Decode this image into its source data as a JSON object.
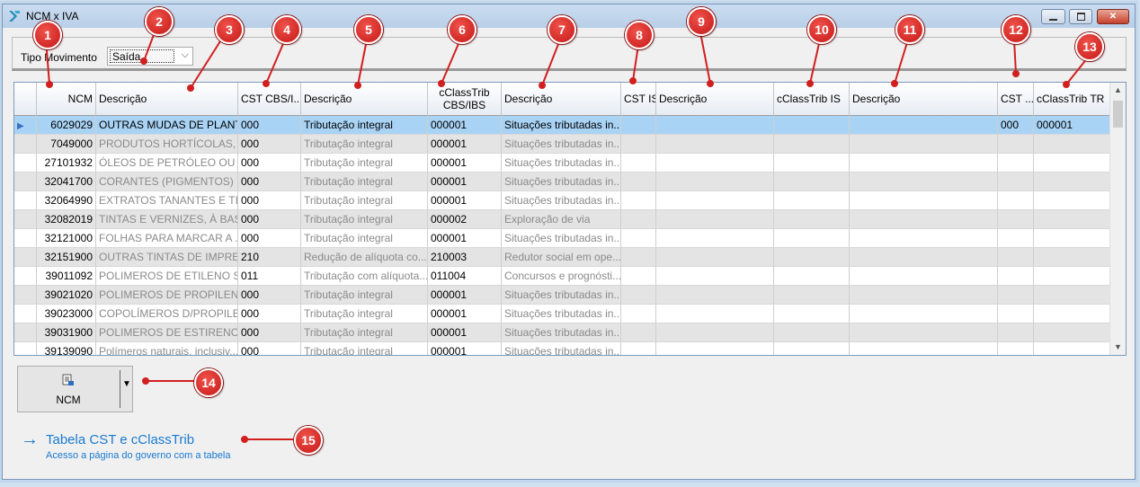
{
  "window": {
    "title": "NCM x IVA",
    "controls": [
      "minimize-icon",
      "maximize-icon",
      "close-icon"
    ]
  },
  "filter": {
    "label": "Tipo Movimento",
    "value": "Saída"
  },
  "grid": {
    "columns": [
      "NCM",
      "Descrição",
      "CST CBS/I...",
      "Descrição",
      "cClassTrib CBS/IBS",
      "Descrição",
      "CST IS",
      "Descrição",
      "cClassTrib IS",
      "Descrição",
      "CST ...",
      "cClassTrib TR"
    ],
    "rows": [
      [
        "6029029",
        "OUTRAS MUDAS DE PLANT...",
        "000",
        "Tributação integral",
        "000001",
        "Situações tributadas in...",
        "",
        "",
        "",
        "",
        "000",
        "000001"
      ],
      [
        "7049000",
        "PRODUTOS HORTÍCOLAS, P...",
        "000",
        "Tributação integral",
        "000001",
        "Situações tributadas in...",
        "",
        "",
        "",
        "",
        "",
        ""
      ],
      [
        "27101932",
        "ÓLEOS DE PETRÓLEO OU D...",
        "000",
        "Tributação integral",
        "000001",
        "Situações tributadas in...",
        "",
        "",
        "",
        "",
        "",
        ""
      ],
      [
        "32041700",
        "CORANTES (PIGMENTOS) N...",
        "000",
        "Tributação integral",
        "000001",
        "Situações tributadas in...",
        "",
        "",
        "",
        "",
        "",
        ""
      ],
      [
        "32064990",
        "EXTRATOS TANANTES E TIN...",
        "000",
        "Tributação integral",
        "000001",
        "Situações tributadas in...",
        "",
        "",
        "",
        "",
        "",
        ""
      ],
      [
        "32082019",
        "TINTAS E VERNIZES, À BASE...",
        "000",
        "Tributação integral",
        "000002",
        "Exploração de via",
        "",
        "",
        "",
        "",
        "",
        ""
      ],
      [
        "32121000",
        "FOLHAS PARA MARCAR A ...",
        "000",
        "Tributação integral",
        "000001",
        "Situações tributadas in...",
        "",
        "",
        "",
        "",
        "",
        ""
      ],
      [
        "32151900",
        "OUTRAS TINTAS DE IMPRES...",
        "210",
        "Redução de alíquota co...",
        "210003",
        "Redutor social em ope...",
        "",
        "",
        "",
        "",
        "",
        ""
      ],
      [
        "39011092",
        "POLIMEROS DE ETILENO SE...",
        "011",
        "Tributação com alíquota...",
        "011004",
        "Concursos e prognósti...",
        "",
        "",
        "",
        "",
        "",
        ""
      ],
      [
        "39021020",
        "POLIMEROS DE PROPILEN...",
        "000",
        "Tributação integral",
        "000001",
        "Situações tributadas in...",
        "",
        "",
        "",
        "",
        "",
        ""
      ],
      [
        "39023000",
        "COPOLÍMEROS D/PROPILE...",
        "000",
        "Tributação integral",
        "000001",
        "Situações tributadas in...",
        "",
        "",
        "",
        "",
        "",
        ""
      ],
      [
        "39031900",
        "POLIMEROS DE ESTIRENO E...",
        "000",
        "Tributação integral",
        "000001",
        "Situações tributadas in...",
        "",
        "",
        "",
        "",
        "",
        ""
      ],
      [
        "39139090",
        "Polímeros naturais, inclusiv...",
        "000",
        "Tributação integral",
        "000001",
        "Situações tributadas in...",
        "",
        "",
        "",
        "",
        "",
        ""
      ]
    ],
    "selected_row": 0
  },
  "ncm_button": {
    "label": "NCM",
    "icon": "table-export-icon"
  },
  "link": {
    "title": "Tabela CST e cClassTrib",
    "subtitle": "Acesso a página do governo com a tabela"
  },
  "callouts": [
    "1",
    "2",
    "3",
    "4",
    "5",
    "6",
    "7",
    "8",
    "9",
    "10",
    "11",
    "12",
    "13",
    "14",
    "15"
  ],
  "colors": {
    "callout": "#d11f1f",
    "selection": "#a9d3f5",
    "link": "#1a7ad0",
    "alt_row": "#e4e4e4"
  }
}
